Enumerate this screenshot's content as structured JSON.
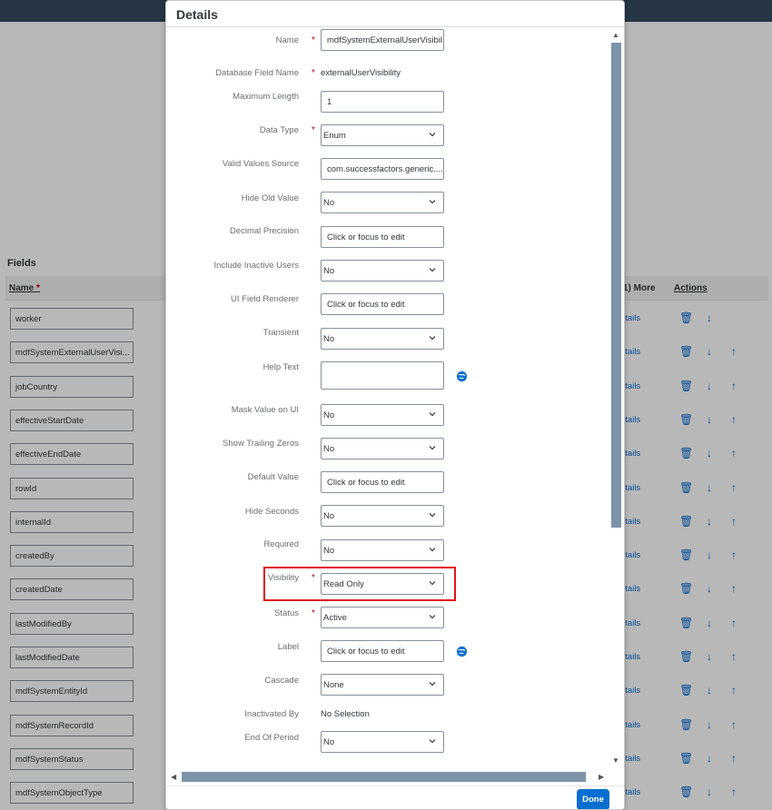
{
  "background": {
    "fields_title": "Fields",
    "header": {
      "name_col": "Name",
      "required_mark": "*",
      "more_col": "1) More",
      "actions_col": "Actions"
    },
    "details_link": "etails",
    "rows": [
      "worker",
      "mdfSystemExternalUserVisi...",
      "jobCountry",
      "effectiveStartDate",
      "effectiveEndDate",
      "rowId",
      "internalId",
      "createdBy",
      "createdDate",
      "lastModifiedBy",
      "lastModifiedDate",
      "mdfSystemEntityId",
      "mdfSystemRecordId",
      "mdfSystemStatus",
      "mdfSystemObjectType"
    ]
  },
  "dialog": {
    "title": "Details",
    "fields": {
      "name": {
        "label": "Name",
        "value": "mdfSystemExternalUserVisibil"
      },
      "db_field_name": {
        "label": "Database Field Name",
        "value": "externalUserVisibility"
      },
      "max_length": {
        "label": "Maximum Length",
        "value": "1"
      },
      "data_type": {
        "label": "Data Type",
        "value": "Enum"
      },
      "valid_values_source": {
        "label": "Valid Values Source",
        "value": "com.successfactors.generic...."
      },
      "hide_old_value": {
        "label": "Hide Old Value",
        "value": "No"
      },
      "decimal_precision": {
        "label": "Decimal Precision",
        "placeholder": "Click or focus to edit"
      },
      "include_inactive_users": {
        "label": "Include Inactive Users",
        "value": "No"
      },
      "ui_field_renderer": {
        "label": "UI Field Renderer",
        "placeholder": "Click or focus to edit"
      },
      "transient": {
        "label": "Transient",
        "value": "No"
      },
      "help_text": {
        "label": "Help Text",
        "value": ""
      },
      "mask_value": {
        "label": "Mask Value on UI",
        "value": "No"
      },
      "show_trailing_zeros": {
        "label": "Show Trailing Zeros",
        "value": "No"
      },
      "default_value": {
        "label": "Default Value",
        "placeholder": "Click or focus to edit"
      },
      "hide_seconds": {
        "label": "Hide Seconds",
        "value": "No"
      },
      "required": {
        "label": "Required",
        "value": "No"
      },
      "visibility": {
        "label": "Visibility",
        "value": "Read Only"
      },
      "status": {
        "label": "Status",
        "value": "Active"
      },
      "label_field": {
        "label": "Label",
        "placeholder": "Click or focus to edit"
      },
      "cascade": {
        "label": "Cascade",
        "value": "None"
      },
      "inactivated_by": {
        "label": "Inactivated By",
        "value": "No Selection"
      },
      "end_of_period": {
        "label": "End Of Period",
        "value": "No"
      }
    },
    "required_mark": "*",
    "done_label": "Done"
  },
  "colors": {
    "accent": "#0a6ed1",
    "required": "#bb0000",
    "highlight": "#e0141e",
    "topbar": "#354a5f"
  }
}
